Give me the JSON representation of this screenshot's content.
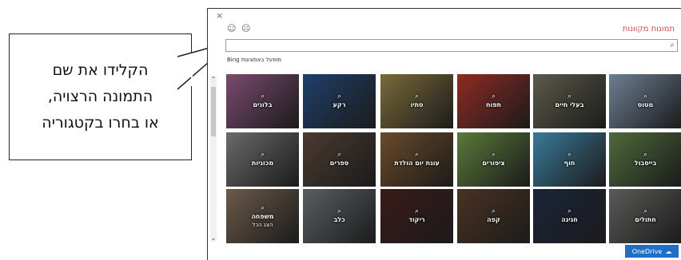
{
  "callout": {
    "text": "הקלידו את שם\nהתמונה הרצויה,\nאו בחרו בקטגוריה"
  },
  "dialog": {
    "close": "×",
    "smile": "☺",
    "sad": "☹",
    "title": "תמונות מקוונות",
    "search_placeholder": "",
    "search_icon": "⌕",
    "bing_note": "מופעל באמצעות Bing",
    "scroll_up": "⌃",
    "scroll_down": "⌄",
    "onedrive_label": "OneDrive",
    "onedrive_icon": "☁"
  },
  "tiles": [
    {
      "label": "מטוס",
      "sub": "",
      "icon": "⌕",
      "color": "#6d7f93"
    },
    {
      "label": "בעלי חיים",
      "sub": "",
      "icon": "⌕",
      "color": "#5b5a4a"
    },
    {
      "label": "תפוח",
      "sub": "",
      "icon": "⌕",
      "color": "#8f2a22"
    },
    {
      "label": "סתיו",
      "sub": "",
      "icon": "⌕",
      "color": "#7a6a3a"
    },
    {
      "label": "רקע",
      "sub": "",
      "icon": "⌕",
      "color": "#1f3f6a"
    },
    {
      "label": "בלונים",
      "sub": "",
      "icon": "⌕",
      "color": "#7b4a6f"
    },
    {
      "label": "בייסבול",
      "sub": "",
      "icon": "⌕",
      "color": "#4e6a3a"
    },
    {
      "label": "חוף",
      "sub": "",
      "icon": "⌕",
      "color": "#3a7a9a"
    },
    {
      "label": "ציפורים",
      "sub": "",
      "icon": "⌕",
      "color": "#5a7a3a"
    },
    {
      "label": "עוגת יום הולדת",
      "sub": "",
      "icon": "⌕",
      "color": "#6a4a2a"
    },
    {
      "label": "ספרים",
      "sub": "",
      "icon": "⌕",
      "color": "#4a3a30"
    },
    {
      "label": "מכוניות",
      "sub": "",
      "icon": "⌕",
      "color": "#6a6a6a"
    },
    {
      "label": "חתולים",
      "sub": "",
      "icon": "⌕",
      "color": "#5a5a58"
    },
    {
      "label": "חגיגה",
      "sub": "",
      "icon": "⌕",
      "color": "#1a2438"
    },
    {
      "label": "קפה",
      "sub": "",
      "icon": "⌕",
      "color": "#4a3222"
    },
    {
      "label": "ריקוד",
      "sub": "",
      "icon": "⌕",
      "color": "#3a1a18"
    },
    {
      "label": "כלב",
      "sub": "",
      "icon": "⌕",
      "color": "#5a5e62"
    },
    {
      "label": "משפחה",
      "sub": "הצג הכל",
      "icon": "⌕",
      "color": "#6a5a4a"
    }
  ]
}
